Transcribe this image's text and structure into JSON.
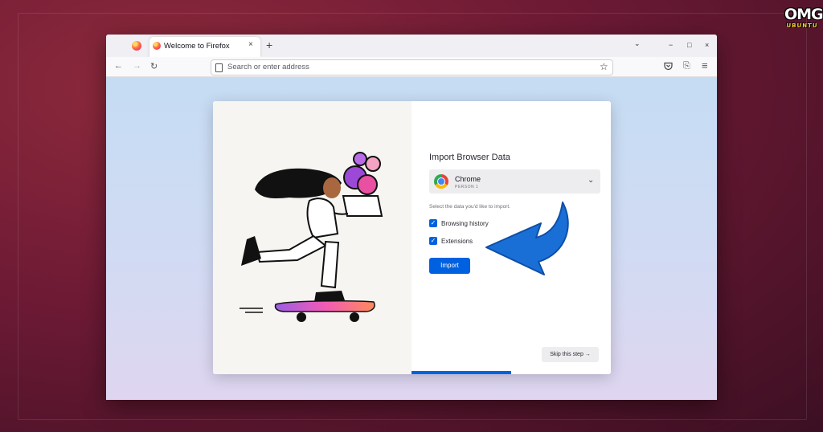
{
  "branding": {
    "logo_text": "OMG",
    "logo_subtext": "UBUNTU"
  },
  "browser": {
    "tab": {
      "title": "Welcome to Firefox",
      "close_icon": "×",
      "new_tab_icon": "+"
    },
    "window_controls": {
      "dropdown_icon": "⌄",
      "minimize_icon": "−",
      "maximize_icon": "□",
      "close_icon": "×"
    },
    "nav": {
      "back_icon": "←",
      "forward_icon": "→",
      "reload_icon": "↻",
      "address_placeholder": "Search or enter address",
      "bookmark_icon": "☆",
      "pocket_icon": "pocket-icon",
      "extensions_icon": "⎘",
      "menu_icon": "≡"
    }
  },
  "dialog": {
    "title": "Import Browser Data",
    "source": {
      "name": "Chrome",
      "profile": "PERSON 1",
      "chevron": "⌄"
    },
    "hint": "Select the data you'd like to import.",
    "options": [
      {
        "label": "Browsing history",
        "checked": true
      },
      {
        "label": "Extensions",
        "checked": true
      }
    ],
    "import_label": "Import",
    "skip_label": "Skip this step →",
    "progress_fraction": 0.5
  },
  "colors": {
    "accent": "#0061e0",
    "annotation_arrow": "#1a6fd6"
  }
}
